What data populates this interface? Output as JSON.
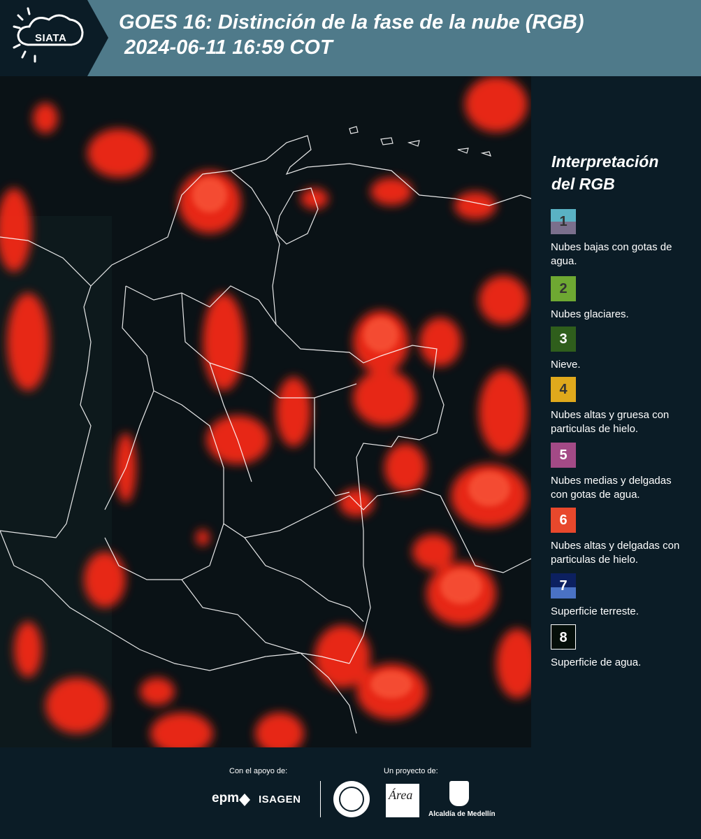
{
  "header": {
    "logo_text": "SIATA",
    "title_line1": "GOES 16: Distinción de la fase de la nube (RGB)",
    "title_line2": "2024-06-11 16:59 COT",
    "colors": {
      "bar": "#4f7a8a",
      "logo_block": "#0b1c26"
    }
  },
  "sidebar": {
    "title_line1": "Interpretación",
    "title_line2": "del RGB",
    "legend": [
      {
        "number": "1",
        "label": "Nubes bajas con gotas de agua.",
        "color_top": "#5ab2c4",
        "color_bottom": "#7a6f8c"
      },
      {
        "number": "2",
        "label": "Nubes glaciares.",
        "color": "#6ea832"
      },
      {
        "number": "3",
        "label": "Nieve.",
        "color": "#2f5e1c"
      },
      {
        "number": "4",
        "label": "Nubes altas y gruesa con particulas de hielo.",
        "color": "#e0a91c"
      },
      {
        "number": "5",
        "label": "Nubes medias y delgadas con gotas de agua.",
        "color": "#a34a86"
      },
      {
        "number": "6",
        "label": "Nubes altas y delgadas con particulas de hielo.",
        "color": "#e8482c"
      },
      {
        "number": "7",
        "label": "Superficie terreste.",
        "color_top": "#0c2060",
        "color_bottom": "#4a72c4"
      },
      {
        "number": "8",
        "label": "Superficie de agua.",
        "color": "#050f0a"
      }
    ]
  },
  "footer": {
    "support_label": "Con el apoyo de:",
    "project_label": "Un proyecto de:",
    "sponsor_epm": "epm",
    "sponsor_isagen": "ISAGEN",
    "amva_text": "Área",
    "alcaldia_label": "Alcaldía de Medellín"
  },
  "map": {
    "cloud_color": "#ff2a14",
    "background_color": "#0a1216",
    "border_color": "#ffffff"
  }
}
